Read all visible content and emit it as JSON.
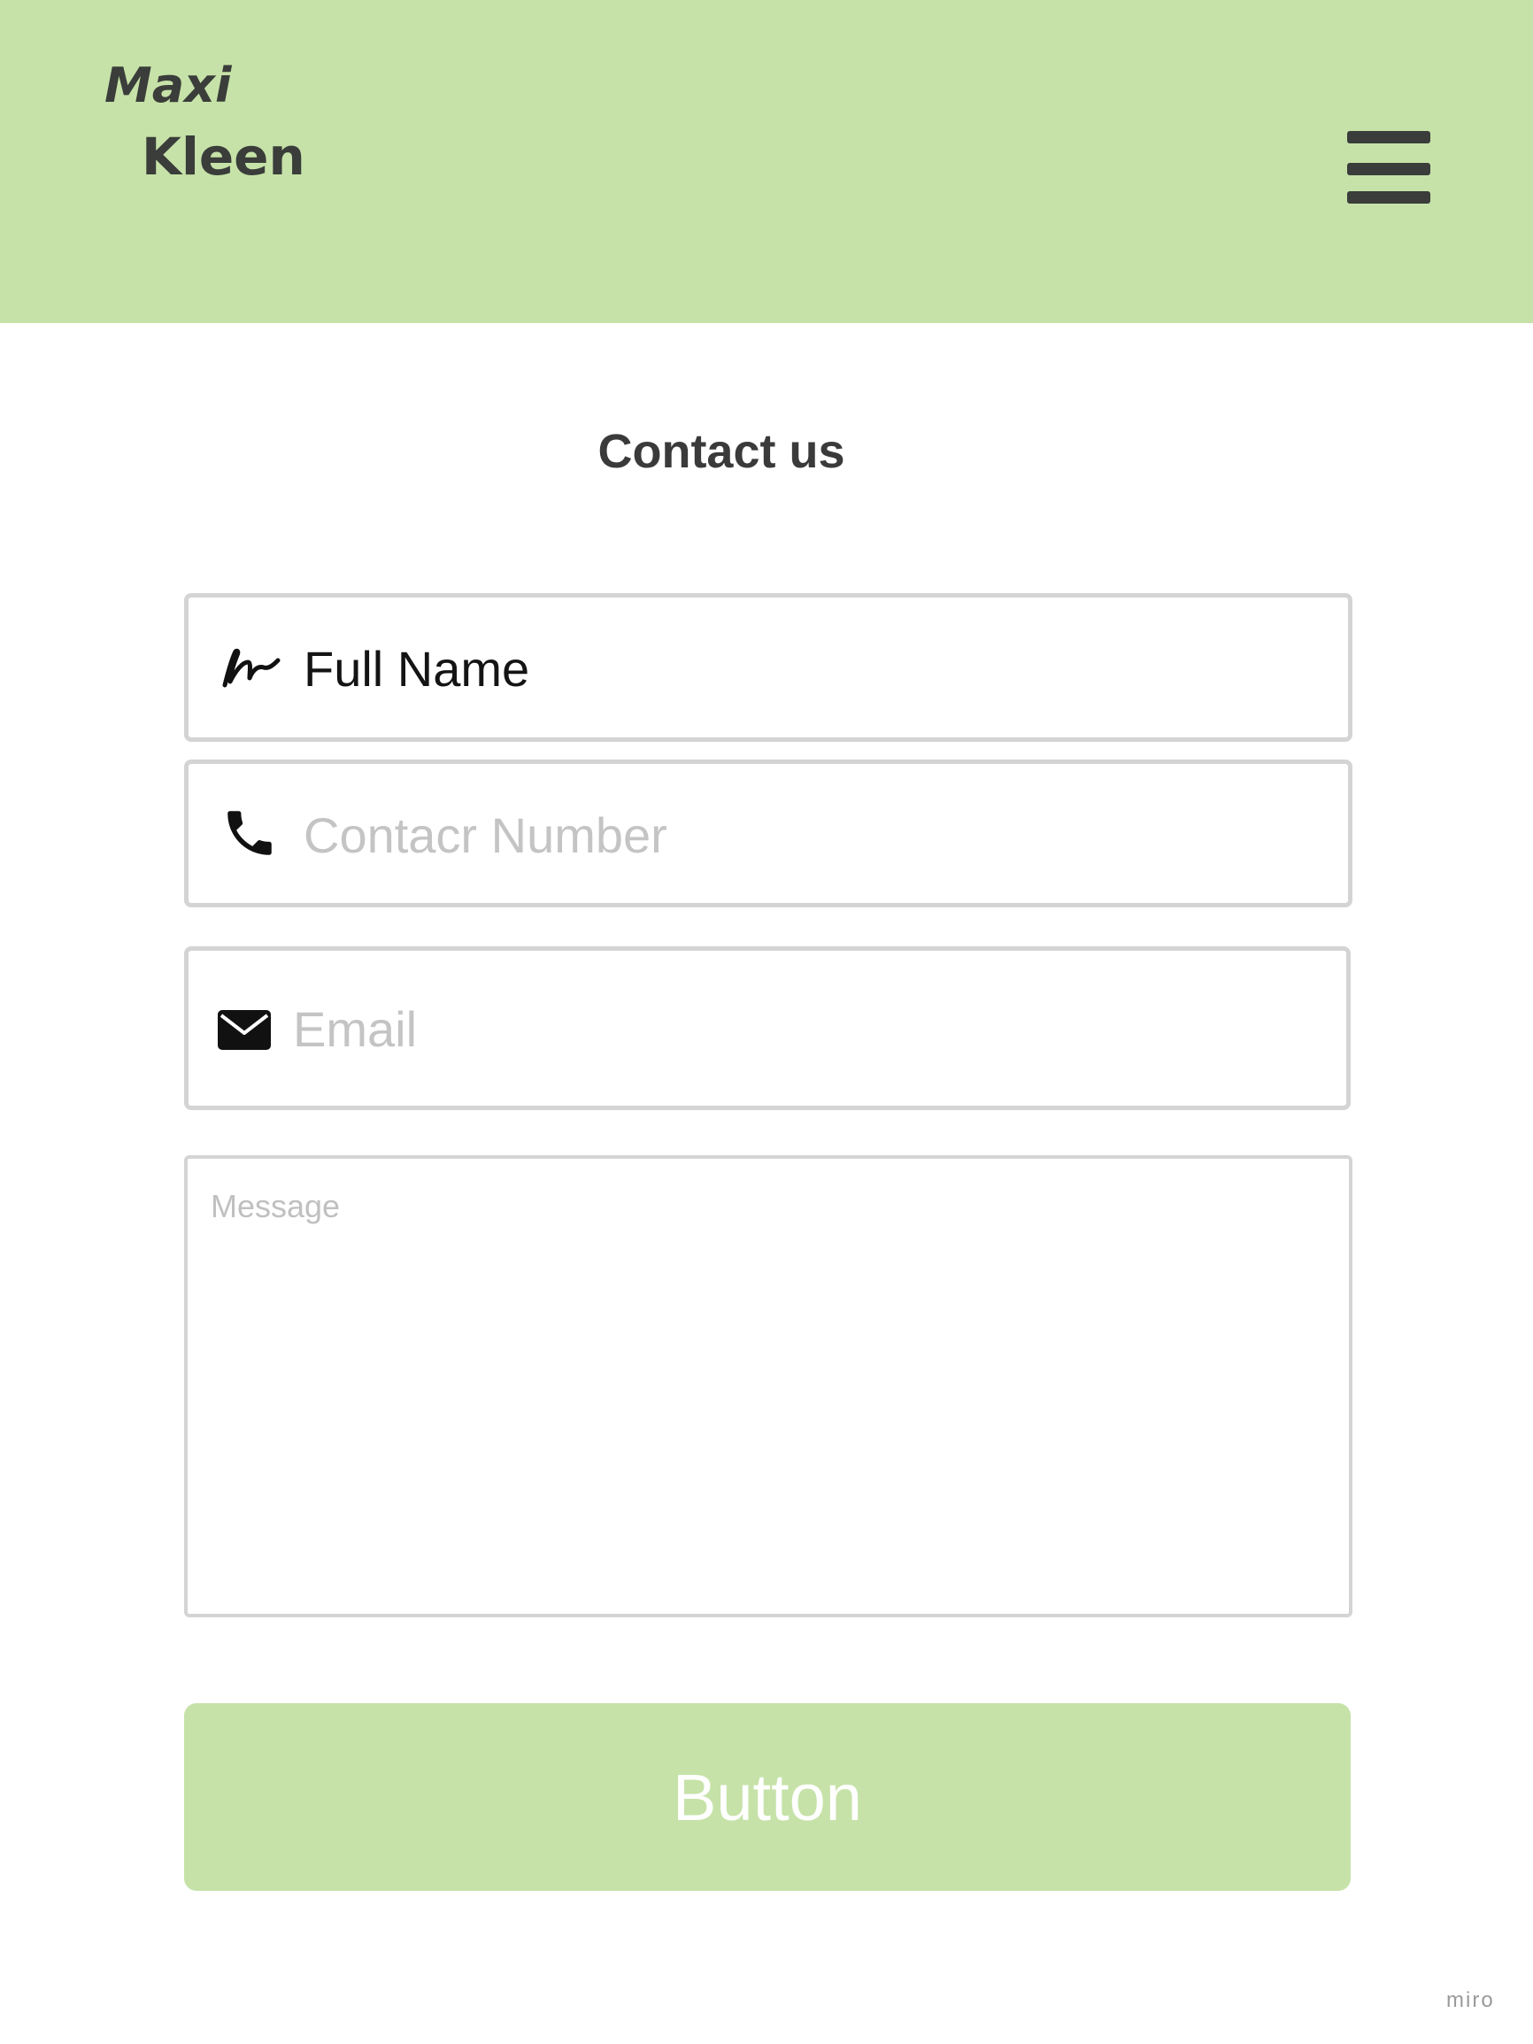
{
  "header": {
    "logo_line1": "Maxi",
    "logo_line2": "Kleen",
    "menu_icon": "hamburger-menu-icon",
    "background": "#c6e2a8"
  },
  "page": {
    "title": "Contact us"
  },
  "form": {
    "full_name": {
      "value": "Full Name",
      "icon": "signature-icon"
    },
    "contact_number": {
      "placeholder": "Contacr Number",
      "icon": "phone-icon"
    },
    "email": {
      "placeholder": "Email",
      "icon": "envelope-icon"
    },
    "message": {
      "placeholder": "Message"
    },
    "submit_label": "Button",
    "submit_color": "#c6e2a8"
  },
  "watermark": "miro"
}
